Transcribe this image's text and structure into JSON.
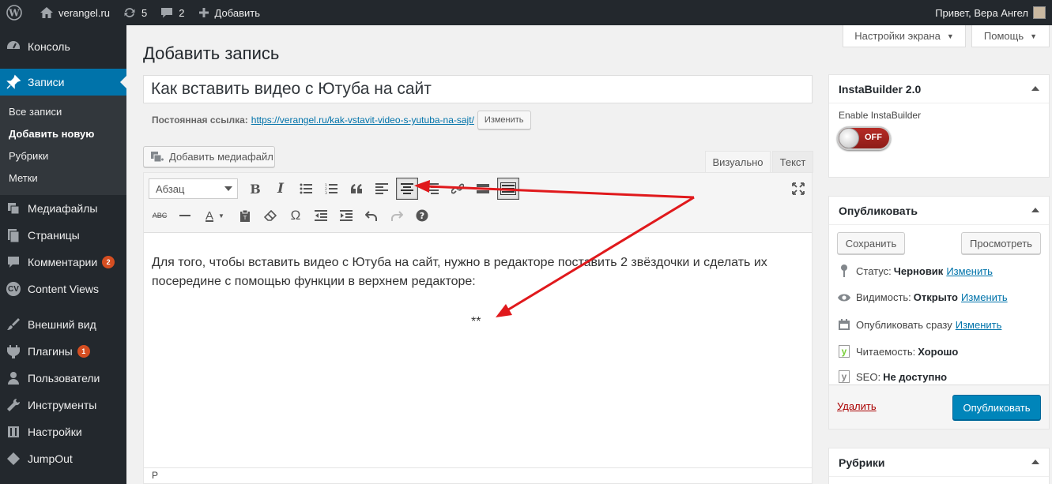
{
  "admin_bar": {
    "site_name": "verangel.ru",
    "updates_count": "5",
    "comments_count": "2",
    "new_label": "Добавить",
    "greeting": "Привет, Вера Ангел"
  },
  "sidebar": {
    "items": [
      {
        "label": "Консоль",
        "icon": "dashboard-icon"
      },
      {
        "label": "Записи",
        "icon": "pin-icon"
      },
      {
        "label": "Медиафайлы",
        "icon": "media-icon"
      },
      {
        "label": "Страницы",
        "icon": "pages-icon"
      },
      {
        "label": "Комментарии",
        "icon": "comments-icon",
        "badge": "2"
      },
      {
        "label": "Content Views",
        "icon": "cv-icon",
        "icon_text": "CV"
      },
      {
        "label": "Внешний вид",
        "icon": "brush-icon"
      },
      {
        "label": "Плагины",
        "icon": "plugin-icon",
        "badge": "1"
      },
      {
        "label": "Пользователи",
        "icon": "users-icon"
      },
      {
        "label": "Инструменты",
        "icon": "tools-icon"
      },
      {
        "label": "Настройки",
        "icon": "settings-icon"
      },
      {
        "label": "JumpOut",
        "icon": "jumpout-icon"
      }
    ],
    "submenu": [
      "Все записи",
      "Добавить новую",
      "Рубрики",
      "Метки"
    ]
  },
  "screen_options": "Настройки экрана",
  "help": "Помощь",
  "page_title": "Добавить запись",
  "post_title": "Как вставить видео с Ютуба на сайт",
  "permalink": {
    "label": "Постоянная ссылка:",
    "base": "https://verangel.ru/",
    "slug": "kak-vstavit-video-s-yutuba-na-sajt",
    "trail": "/",
    "button": "Изменить"
  },
  "add_media": "Добавить медиафайл",
  "editor_tabs": {
    "visual": "Визуально",
    "text": "Текст"
  },
  "format_select": "Абзац",
  "content": {
    "paragraph": "Для того, чтобы вставить видео с Ютуба на сайт, нужно в редакторе поставить 2 звёздочки и сделать их посередине с помощью функции в верхнем редакторе:",
    "stars": "**"
  },
  "status_path": "P",
  "instabuilder": {
    "title": "InstaBuilder 2.0",
    "enable_label": "Enable InstaBuilder",
    "toggle_state": "OFF"
  },
  "publish_box": {
    "title": "Опубликовать",
    "save": "Сохранить",
    "preview": "Просмотреть",
    "status_label": "Статус:",
    "status_value": "Черновик",
    "visibility_label": "Видимость:",
    "visibility_value": "Открыто",
    "schedule_label": "Опубликовать сразу",
    "readability_label": "Читаемость:",
    "readability_value": "Хорошо",
    "seo_label": "SEO:",
    "seo_value": "Не доступно",
    "edit": "Изменить",
    "delete": "Удалить",
    "publish": "Опубликовать"
  },
  "categories_box": {
    "title": "Рубрики"
  },
  "colors": {
    "accent": "#0073aa",
    "publish": "#0085ba",
    "annotation": "#e0191c",
    "sidebar": "#23282d"
  }
}
